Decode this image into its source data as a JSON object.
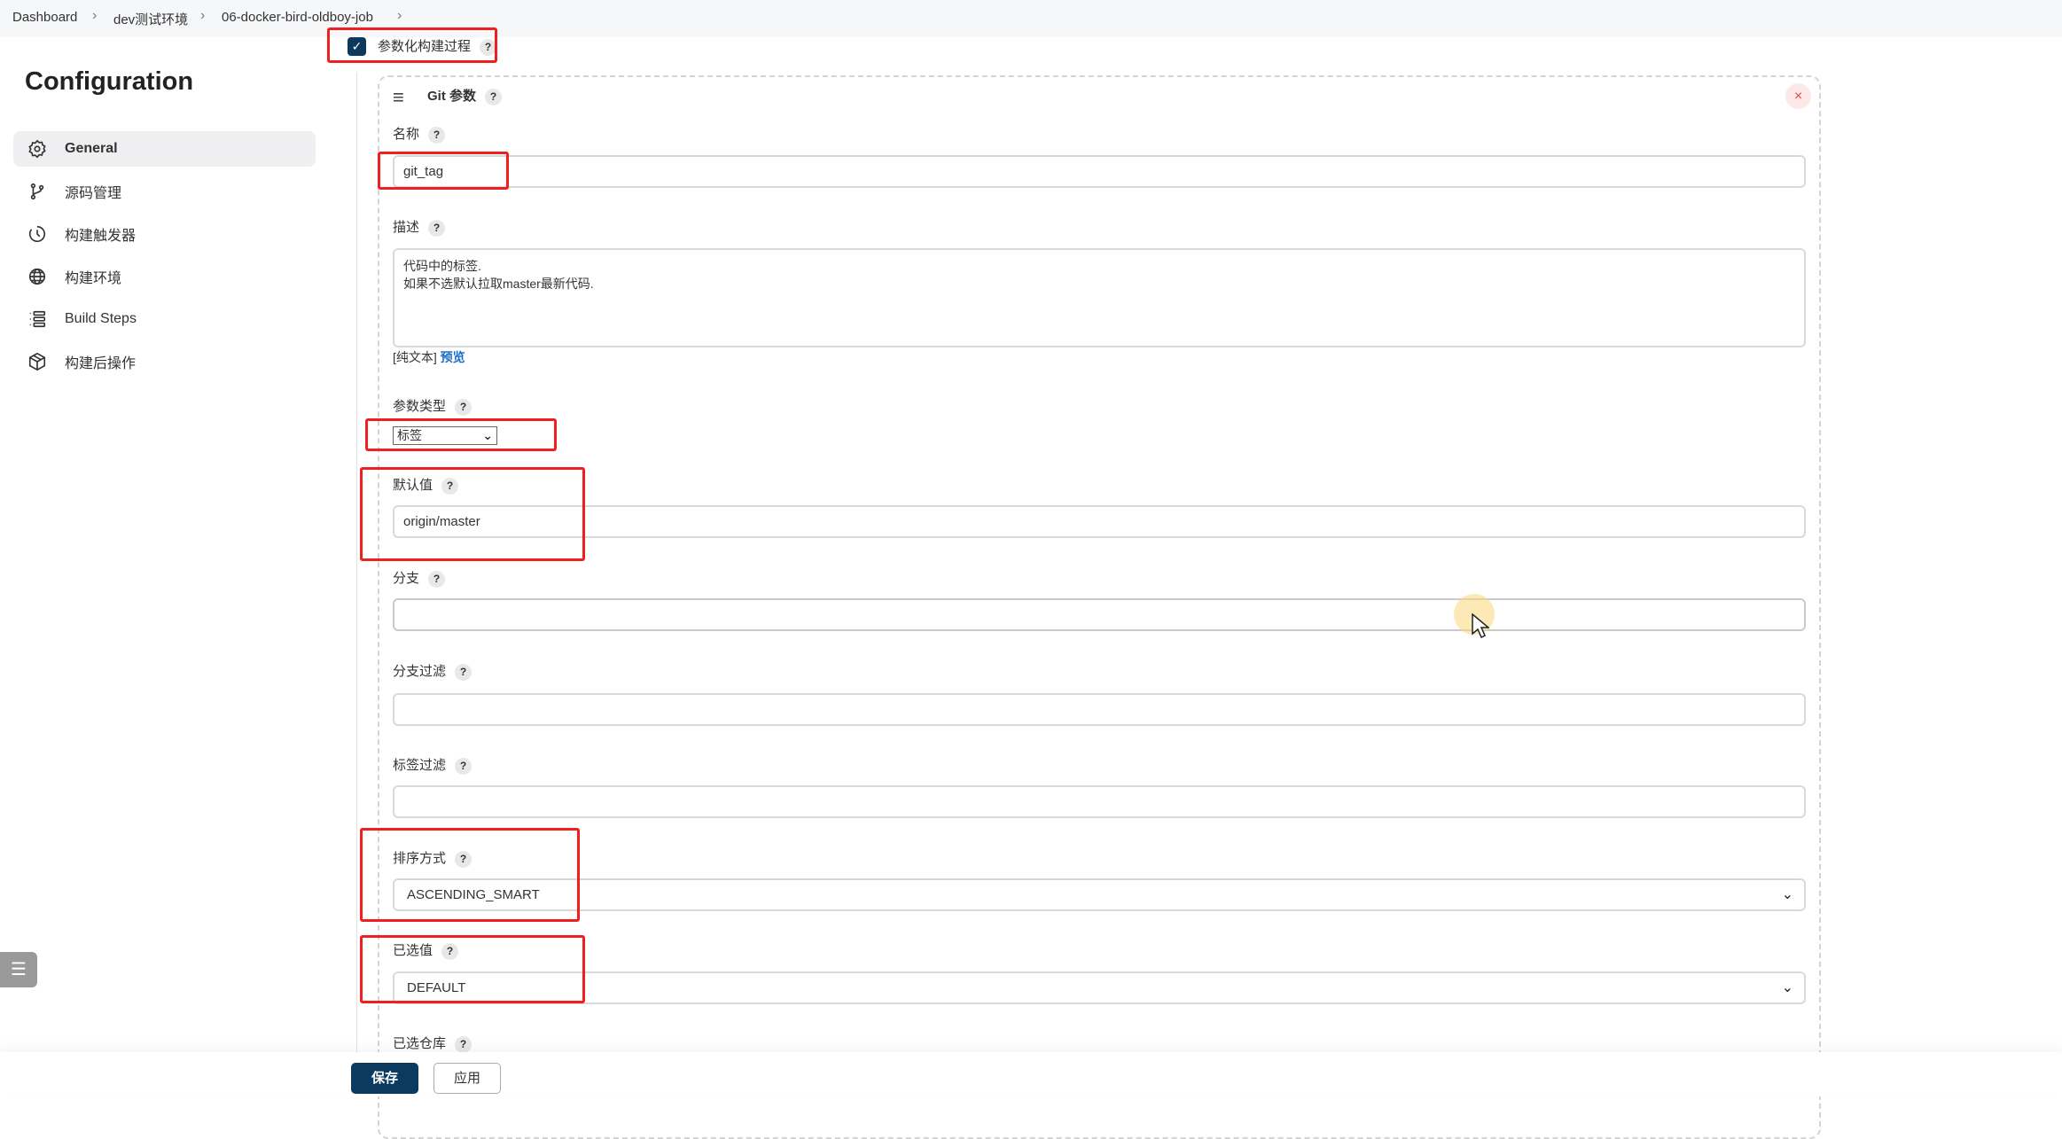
{
  "breadcrumb": [
    "Dashboard",
    "dev测试环境",
    "06-docker-bird-oldboy-job"
  ],
  "parameterized": {
    "label": "参数化构建过程",
    "checked": true,
    "help": "?"
  },
  "sidebar": {
    "title": "Configuration",
    "items": [
      {
        "label": "General",
        "icon": "gear-icon",
        "active": true
      },
      {
        "label": "源码管理",
        "icon": "branch-icon"
      },
      {
        "label": "构建触发器",
        "icon": "clock-icon"
      },
      {
        "label": "构建环境",
        "icon": "globe-icon"
      },
      {
        "label": "Build Steps",
        "icon": "list-icon"
      },
      {
        "label": "构建后操作",
        "icon": "package-icon"
      }
    ]
  },
  "card": {
    "title": "Git 参数",
    "close": "×",
    "name": {
      "label": "名称",
      "value": "git_tag"
    },
    "description": {
      "label": "描述",
      "value": "代码中的标签.\n如果不选默认拉取master最新代码.",
      "plain": "[纯文本]",
      "preview": "预览"
    },
    "param_type": {
      "label": "参数类型",
      "value": "标签"
    },
    "default_value": {
      "label": "默认值",
      "value": "origin/master"
    },
    "branch": {
      "label": "分支",
      "value": ""
    },
    "branch_filter": {
      "label": "分支过滤",
      "value": ""
    },
    "tag_filter": {
      "label": "标签过滤",
      "value": ""
    },
    "sort_mode": {
      "label": "排序方式",
      "value": "ASCENDING_SMART"
    },
    "selected_value": {
      "label": "已选值",
      "value": "DEFAULT"
    },
    "selected_repo": {
      "label": "已选仓库"
    }
  },
  "footer": {
    "save": "保存",
    "apply": "应用"
  },
  "colors": {
    "primary": "#0c3a5e",
    "link": "#1a6fc9",
    "highlight": "#f02020"
  }
}
